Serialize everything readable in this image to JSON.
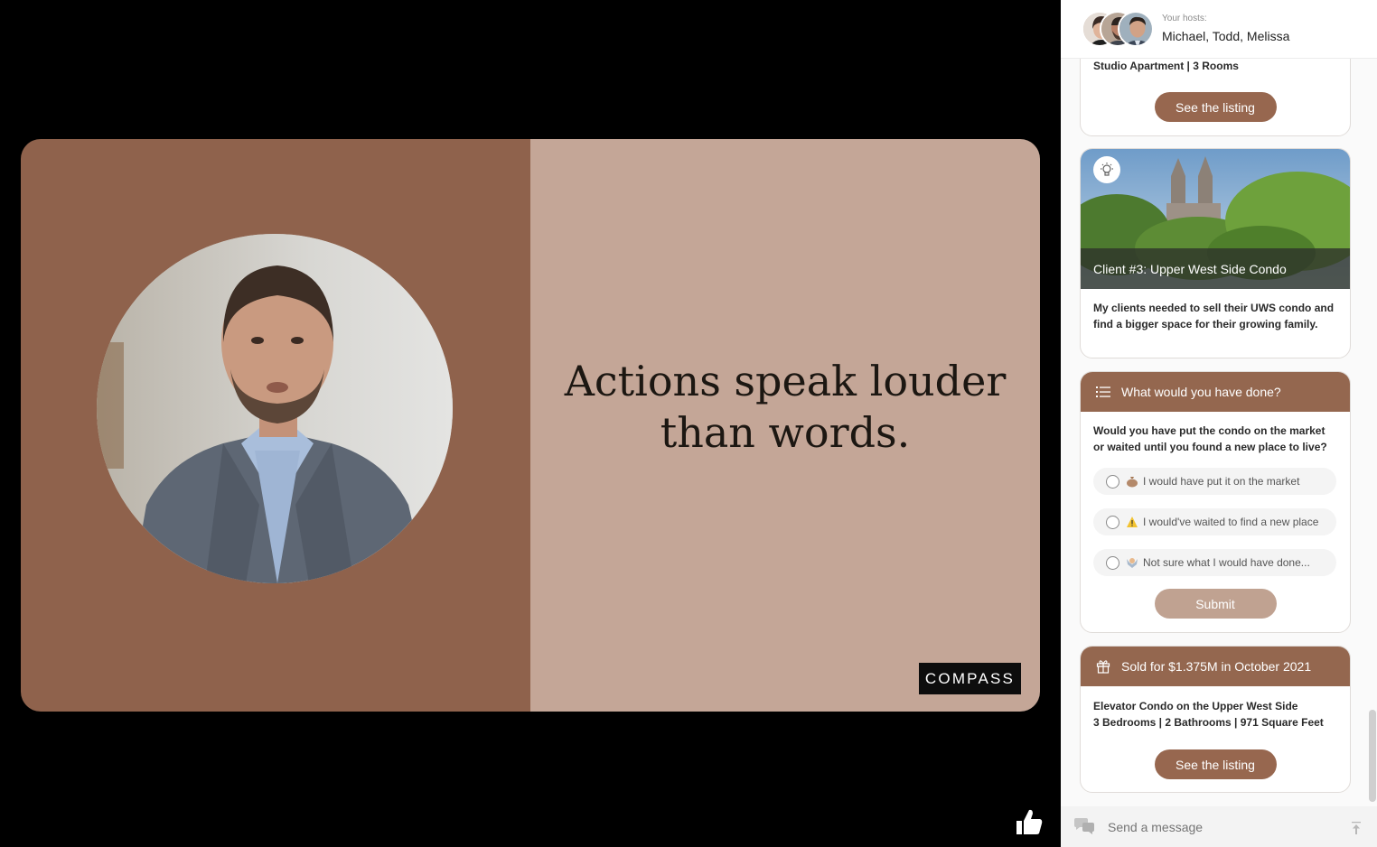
{
  "slide": {
    "headline_line1": "Actions speak louder",
    "headline_line2": "than words.",
    "logo_text": "COMPASS",
    "bg_left": "#8f624c",
    "bg_right": "#c4a697"
  },
  "hosts": {
    "caption": "Your hosts:",
    "names": "Michael, Todd, Melissa"
  },
  "listing_card_top": {
    "summary": "Studio Apartment | 3 Rooms",
    "button": "See the listing"
  },
  "story_card": {
    "image_caption": "Client #3: Upper West Side Condo",
    "body": "My clients needed to sell their UWS condo and find a bigger space for their growing family.",
    "icon": "lightbulb-icon"
  },
  "poll_card": {
    "title": "What would you have done?",
    "question": "Would you have put the condo on the market or waited until you found a new place to live?",
    "options": [
      {
        "label": "I would have put it on the market",
        "icon": "money-bag-icon"
      },
      {
        "label": "I would've waited to find a new place",
        "icon": "warning-icon"
      },
      {
        "label": "Not sure what I would have done...",
        "icon": "shrug-icon"
      }
    ],
    "submit": "Submit"
  },
  "sold_card": {
    "title": "Sold for $1.375M in October 2021",
    "line1": "Elevator Condo on the Upper West Side",
    "line2": "3 Bedrooms | 2 Bathrooms | 971 Square Feet",
    "button": "See the listing"
  },
  "composer": {
    "placeholder": "Send a message"
  },
  "colors": {
    "accent": "#97674f",
    "accent_light": "#c0a291"
  }
}
